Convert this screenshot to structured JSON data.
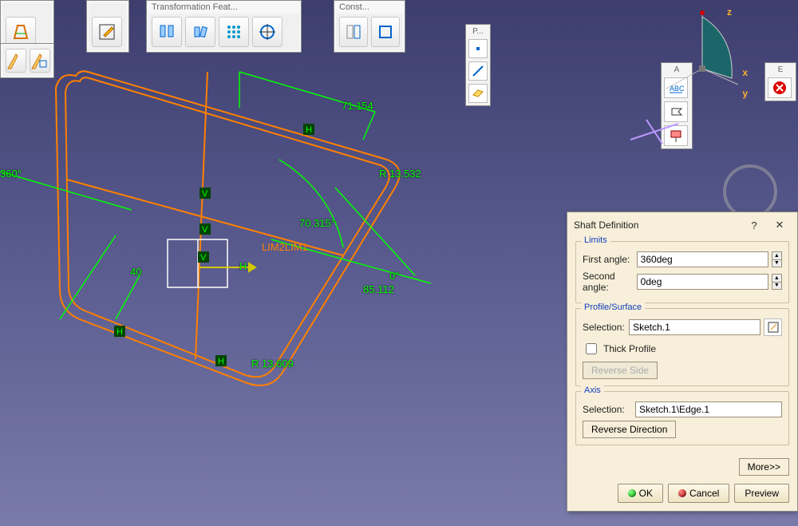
{
  "toolbars": {
    "transformation": {
      "title": "Transformation Feat..."
    },
    "construction": {
      "title": "Const..."
    },
    "profile": {
      "title": "P..."
    },
    "annotation": {
      "title": "A"
    },
    "error": {
      "title": "E"
    }
  },
  "dialog": {
    "title": "Shaft Definition",
    "help": "?",
    "close": "✕",
    "limits": {
      "label": "Limits",
      "first_angle_label": "First angle:",
      "first_angle_value": "360deg",
      "second_angle_label": "Second angle:",
      "second_angle_value": "0deg"
    },
    "profile": {
      "label": "Profile/Surface",
      "selection_label": "Selection:",
      "selection_value": "Sketch.1",
      "thick_label": "Thick Profile",
      "reverse_side": "Reverse Side"
    },
    "axis": {
      "label": "Axis",
      "selection_label": "Selection:",
      "selection_value": "Sketch.1\\Edge.1",
      "reverse_direction": "Reverse Direction"
    },
    "more": "More>>",
    "ok": "OK",
    "cancel": "Cancel",
    "preview": "Preview"
  },
  "compass": {
    "x": "x",
    "y": "y",
    "z": "z"
  },
  "dimensions": {
    "d1": "71.154",
    "d2": "R 13.532",
    "d3": "70.315°",
    "d4": "85.112",
    "d5": "0°",
    "d6": "40",
    "d7": "360°",
    "d8": "R 13.609",
    "lim": "LIM2LIM1",
    "h": "H",
    "v": "V"
  }
}
